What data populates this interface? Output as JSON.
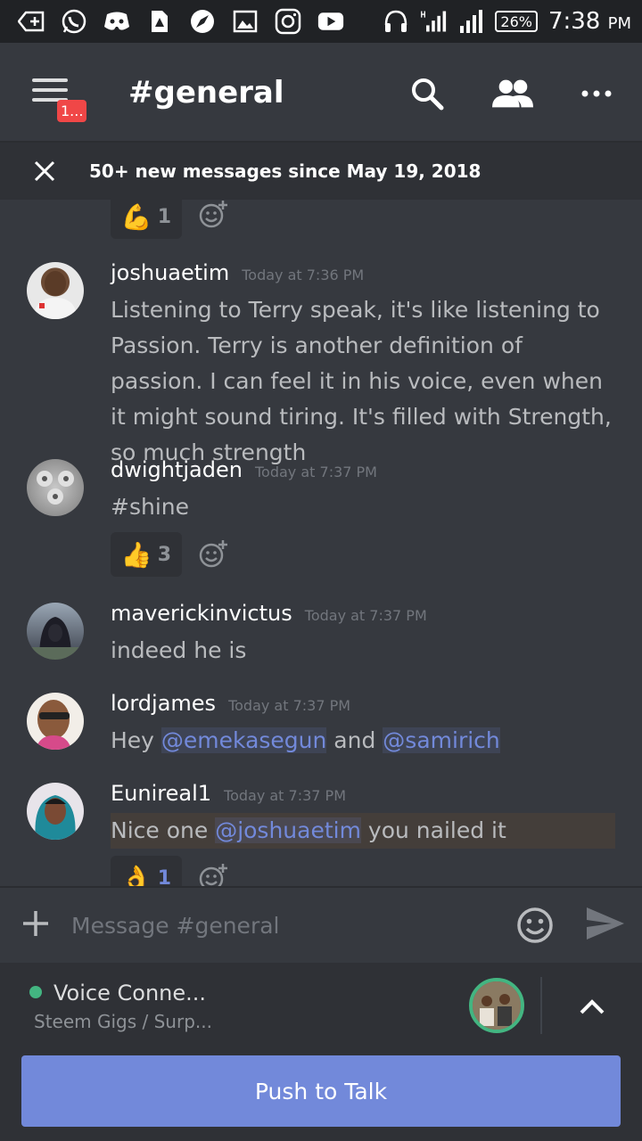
{
  "status_bar": {
    "battery": "26%",
    "time": "7:38",
    "ampm": "PM"
  },
  "header": {
    "channel": "#general",
    "badge": "1..."
  },
  "new_messages": {
    "text": "50+ new messages since May 19, 2018"
  },
  "messages": [
    {
      "author": "joshuaetim",
      "time": "Today at 7:36 PM",
      "text": "Listening to Terry speak, it's like listening to Passion. Terry is another definition of passion. I can feel it in his voice, even when it might sound tiring. It's filled with Strength, so much strength"
    },
    {
      "author": "dwightjaden",
      "time": "Today at 7:37 PM",
      "text": "#shine"
    },
    {
      "author": "maverickinvictus",
      "time": "Today at 7:37 PM",
      "text": "indeed he is"
    },
    {
      "author": "lordjames",
      "time": "Today at 7:37 PM",
      "text_a": "Hey ",
      "mention_1": "@emekasegun",
      "text_b": " and ",
      "mention_2": "@samirich"
    },
    {
      "author": "Eunireal1",
      "time": "Today at 7:37 PM",
      "text_a": "Nice one ",
      "mention": "@joshuaetim",
      "text_b": " you nailed it"
    }
  ],
  "reactions": {
    "top": {
      "emoji": "💪",
      "count": "1"
    },
    "shine": {
      "emoji": "👍",
      "count": "3"
    },
    "nice": {
      "emoji": "👌",
      "count": "1"
    }
  },
  "composer": {
    "placeholder": "Message #general"
  },
  "voice": {
    "status": "Voice Conne...",
    "channel": "Steem Gigs / Surp...",
    "status_color": "#43b581"
  },
  "push_to_talk": "Push to Talk",
  "colors": {
    "background": "#36393f",
    "accent": "#7289da",
    "badge": "#f04747"
  }
}
